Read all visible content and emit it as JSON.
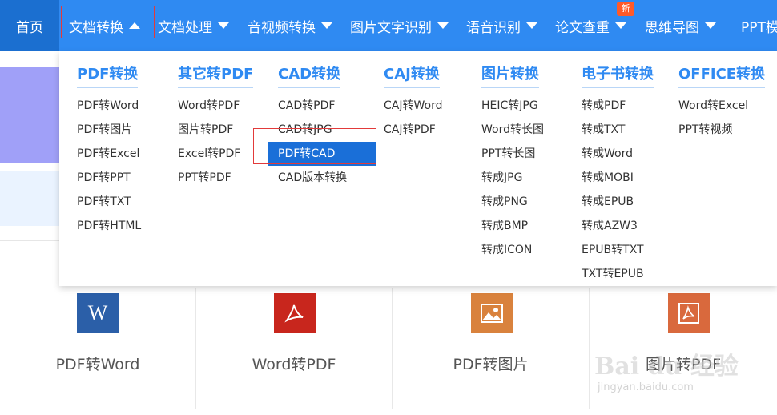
{
  "nav": {
    "items": [
      {
        "label": "首页"
      },
      {
        "label": "文档转换"
      },
      {
        "label": "文档处理"
      },
      {
        "label": "音视频转换"
      },
      {
        "label": "图片文字识别"
      },
      {
        "label": "语音识别"
      },
      {
        "label": "论文查重"
      },
      {
        "label": "思维导图"
      },
      {
        "label": "PPT模"
      }
    ],
    "new_badge": "新"
  },
  "dropdown": {
    "columns": [
      {
        "title": "PDF转换",
        "items": [
          "PDF转Word",
          "PDF转图片",
          "PDF转Excel",
          "PDF转PPT",
          "PDF转TXT",
          "PDF转HTML"
        ]
      },
      {
        "title": "其它转PDF",
        "items": [
          "Word转PDF",
          "图片转PDF",
          "Excel转PDF",
          "PPT转PDF"
        ]
      },
      {
        "title": "CAD转换",
        "items": [
          "CAD转PDF",
          "CAD转JPG",
          "PDF转CAD",
          "CAD版本转换"
        ]
      },
      {
        "title": "CAJ转换",
        "items": [
          "CAJ转Word",
          "CAJ转PDF"
        ]
      },
      {
        "title": "图片转换",
        "items": [
          "HEIC转JPG",
          "Word转长图",
          "PPT转长图",
          "转成JPG",
          "转成PNG",
          "转成BMP",
          "转成ICON"
        ]
      },
      {
        "title": "电子书转换",
        "items": [
          "转成PDF",
          "转成TXT",
          "转成Word",
          "转成MOBI",
          "转成EPUB",
          "转成AZW3",
          "EPUB转TXT",
          "TXT转EPUB"
        ]
      },
      {
        "title": "OFFICE转换",
        "items": [
          "Word转Excel",
          "PPT转视频"
        ]
      }
    ]
  },
  "tools": [
    {
      "label": "PDF转Word",
      "icon_text": "W",
      "color": "#2b5fa8"
    },
    {
      "label": "Word转PDF",
      "icon_text": "",
      "color": "#c8261d"
    },
    {
      "label": "PDF转图片",
      "icon_text": "",
      "color": "#d9823d"
    },
    {
      "label": "图片转PDF",
      "icon_text": "",
      "color": "#d9693d"
    }
  ],
  "watermark": {
    "logo": "Bai du 经验",
    "url": "jingyan.baidu.com"
  },
  "colors": {
    "nav_bg": "#2f8af2",
    "home_bg": "#1b6fd0",
    "accent": "#2f8af2",
    "active_item": "#1a6fd8",
    "highlight_box": "#e23a3a"
  }
}
